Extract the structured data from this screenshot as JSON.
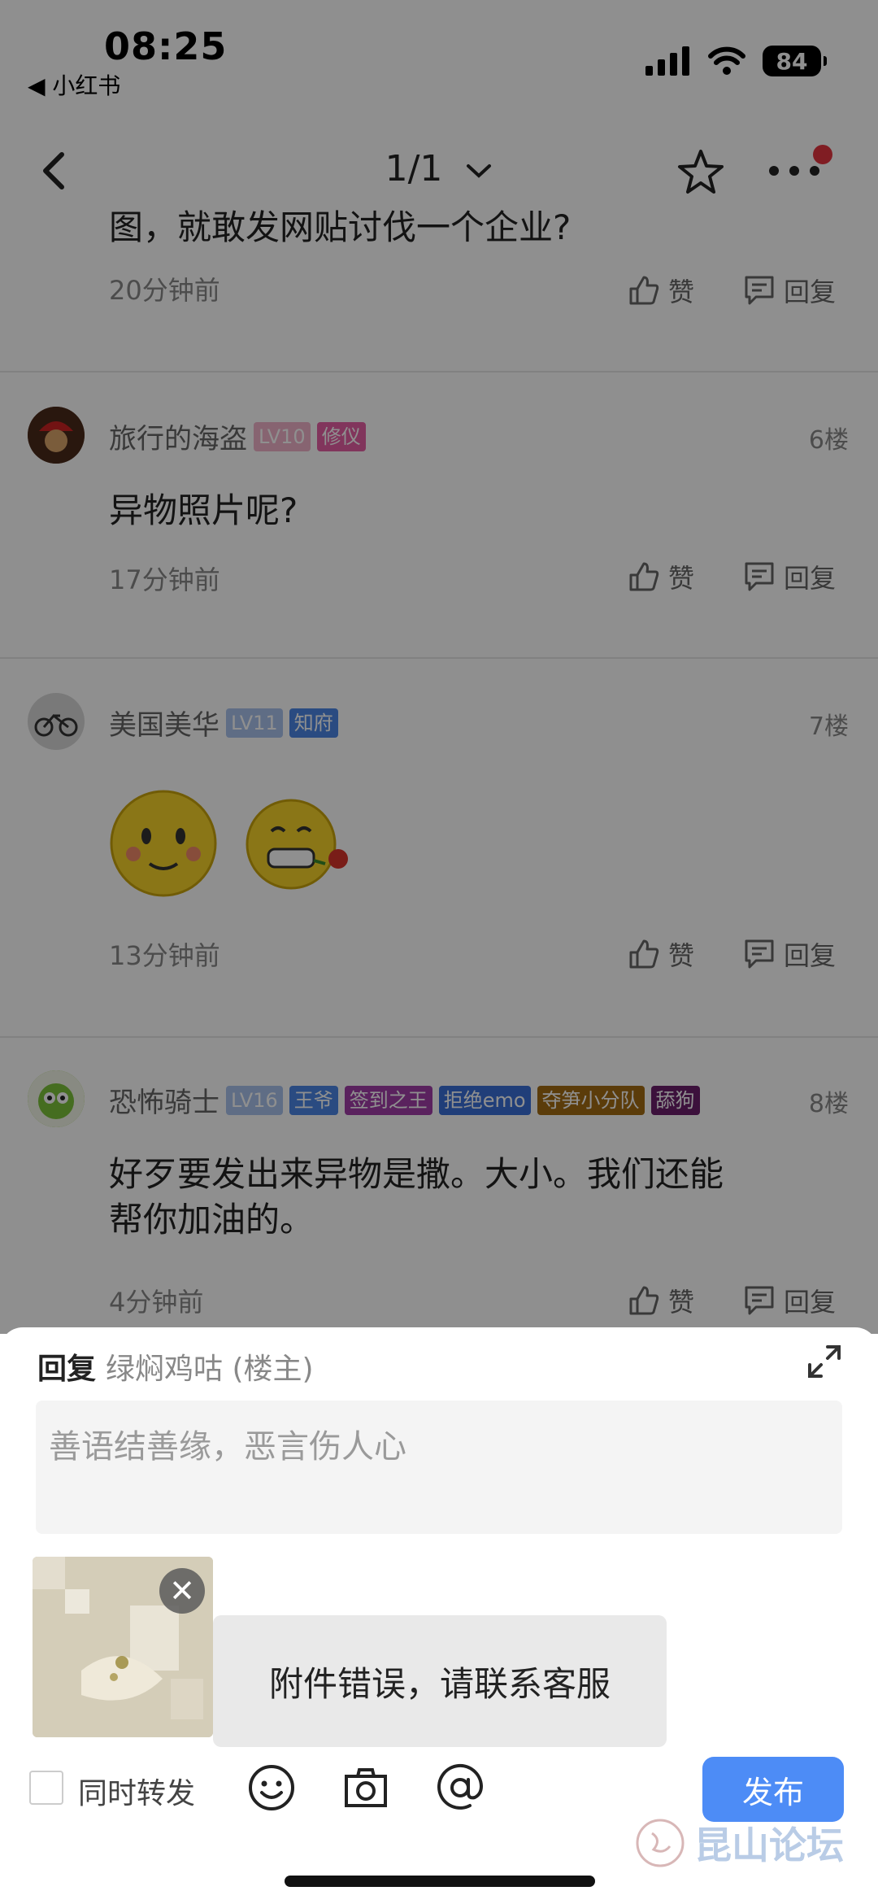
{
  "status_bar": {
    "time": "08:25",
    "back_app": "◀ 小红书",
    "battery": "84"
  },
  "nav": {
    "title": "1/1",
    "chevron": "⌄"
  },
  "comments": [
    {
      "text": "图，就敢发网贴讨伐一个企业?",
      "time": "20分钟前",
      "like": "赞",
      "reply": "回复"
    },
    {
      "user": "旅行的海盗",
      "badges": [
        {
          "label": "LV10",
          "color": "#f1b3c9"
        },
        {
          "label": "修仪",
          "color": "#e75fa4"
        }
      ],
      "floor": "6楼",
      "text": "异物照片呢?",
      "time": "17分钟前",
      "like": "赞",
      "reply": "回复"
    },
    {
      "user": "美国美华",
      "badges": [
        {
          "label": "LV11",
          "color": "#a9c3ee"
        },
        {
          "label": "知府",
          "color": "#4b86e6"
        }
      ],
      "floor": "7楼",
      "time": "13分钟前",
      "like": "赞",
      "reply": "回复"
    },
    {
      "user": "恐怖骑士",
      "badges": [
        {
          "label": "LV16",
          "color": "#a9c3ee"
        },
        {
          "label": "王爷",
          "color": "#4b86e6"
        },
        {
          "label": "签到之王",
          "color": "#a13ea8"
        },
        {
          "label": "拒绝emo",
          "color": "#3a6fd8"
        },
        {
          "label": "夺笋小分队",
          "color": "#a36b12"
        },
        {
          "label": "舔狗",
          "color": "#6b1f6b"
        }
      ],
      "floor": "8楼",
      "text_line1": "好歹要发出来异物是撒。大小。我们还能",
      "text_line2": "帮你加油的。",
      "time": "4分钟前",
      "like": "赞",
      "reply": "回复"
    }
  ],
  "reply_sheet": {
    "reply_label": "回复",
    "reply_target": "绿焖鸡咕 (楼主)",
    "placeholder": "善语结善缘，恶言伤人心",
    "toast": "附件错误，请联系客服",
    "repost_label": "同时转发",
    "publish_label": "发布"
  },
  "watermark": {
    "text": "昆山论坛"
  },
  "colors": {
    "accent": "#4d8cf6",
    "dot": "#e5343f"
  }
}
